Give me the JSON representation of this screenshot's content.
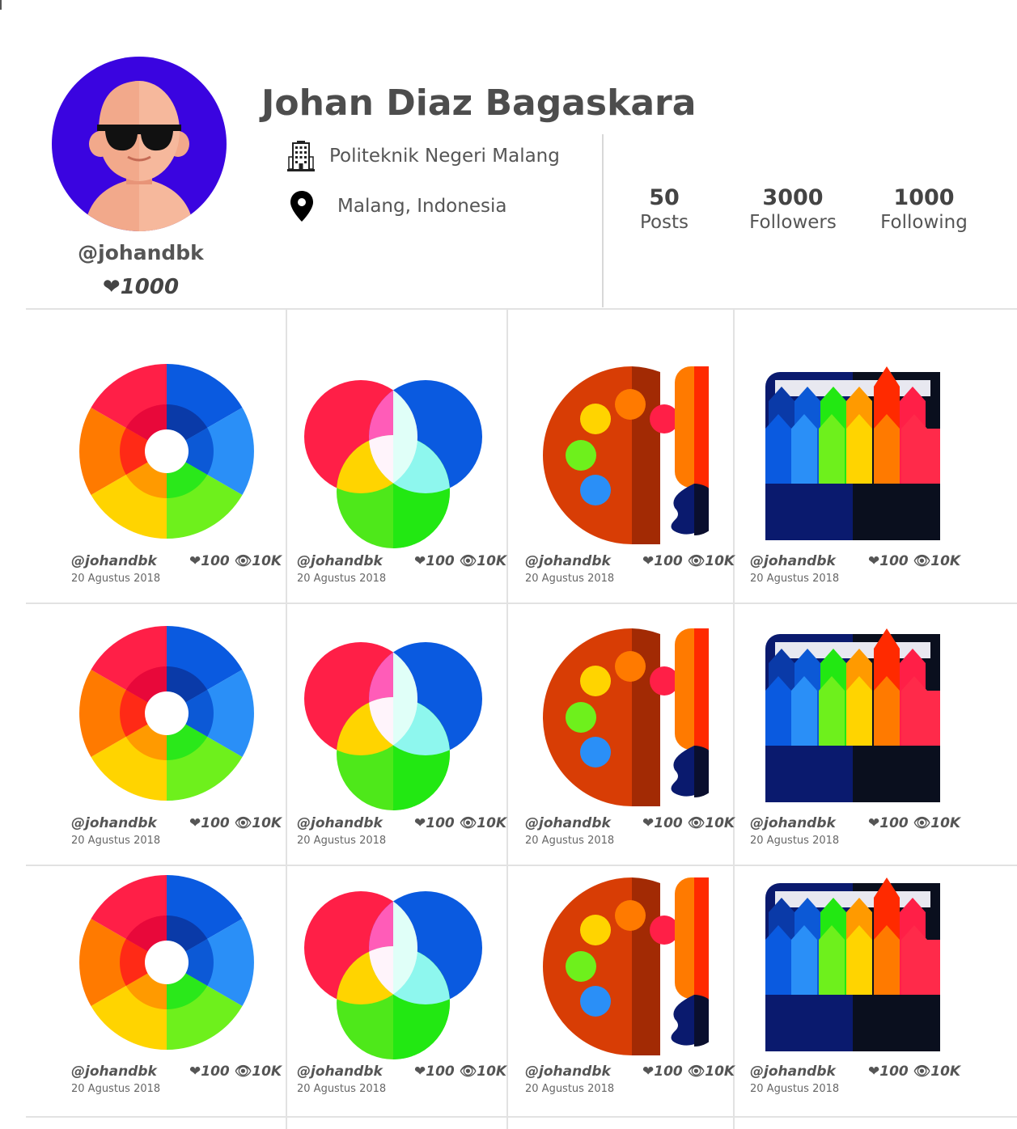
{
  "profile": {
    "name": "Johan Diaz Bagaskara",
    "handle": "@johandbk",
    "likes": "1000",
    "institution": "Politeknik Negeri Malang",
    "location": "Malang, Indonesia"
  },
  "stats": [
    {
      "value": "50",
      "label": "Posts"
    },
    {
      "value": "3000",
      "label": "Followers"
    },
    {
      "value": "1000",
      "label": "Following"
    }
  ],
  "post_meta": {
    "user": "@johandbk",
    "date": "20 Agustus 2018",
    "likes": "100",
    "views": "10K"
  },
  "posts": [
    {
      "icon": "color-wheel-icon"
    },
    {
      "icon": "rgb-circles-icon"
    },
    {
      "icon": "paint-palette-icon"
    },
    {
      "icon": "color-pencils-icon"
    },
    {
      "icon": "color-wheel-icon"
    },
    {
      "icon": "rgb-circles-icon"
    },
    {
      "icon": "paint-palette-icon"
    },
    {
      "icon": "color-pencils-icon"
    },
    {
      "icon": "color-wheel-icon"
    },
    {
      "icon": "rgb-circles-icon"
    },
    {
      "icon": "paint-palette-icon"
    },
    {
      "icon": "color-pencils-icon"
    }
  ],
  "colors": {
    "avatar_bg": "#3a04e0",
    "text": "#4d4d4d",
    "divider": "#e2e2e2"
  }
}
